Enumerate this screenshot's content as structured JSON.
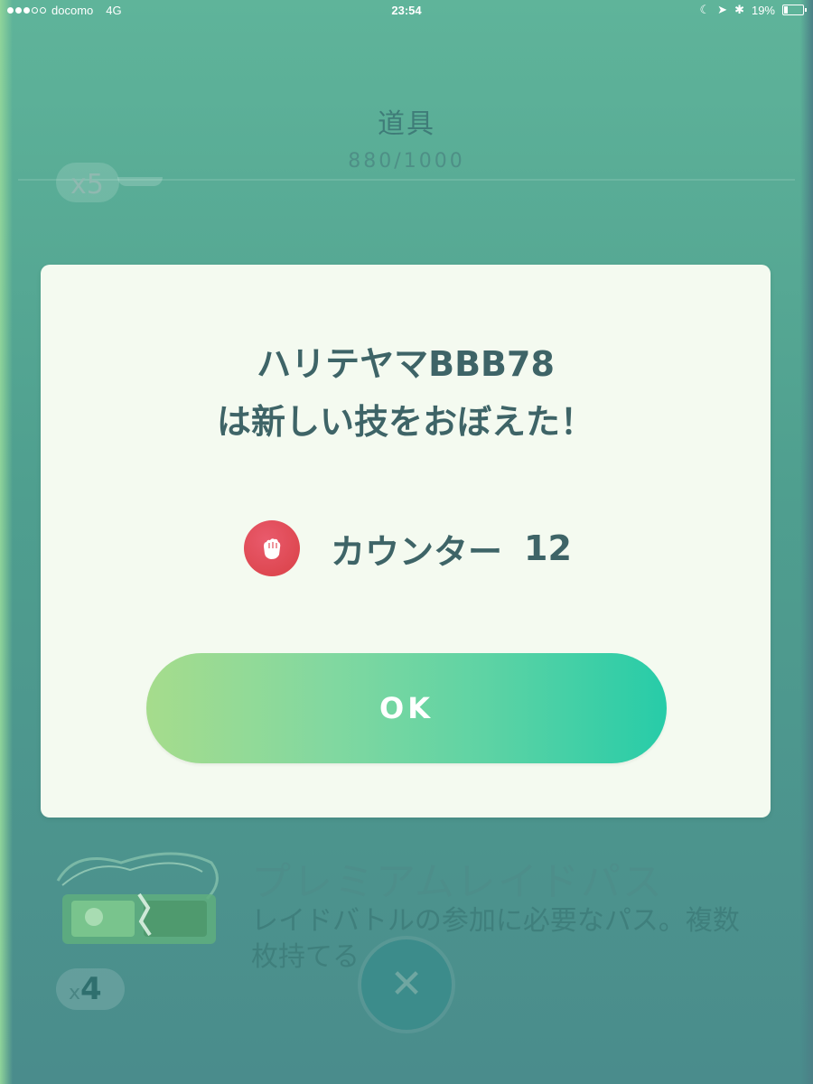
{
  "status_bar": {
    "carrier": "docomo",
    "network": "4G",
    "time": "23:54",
    "battery_percent": "19%",
    "battery_level": 0.19
  },
  "inventory": {
    "title": "道具",
    "count": "880/1000",
    "partial_item_count": "x5",
    "item": {
      "name": "プレミアムレイドパス",
      "description": "レイドバトルの参加に必要なパス。複数枚持てる",
      "count_prefix": "x",
      "count": "4"
    },
    "close_icon": "close-icon"
  },
  "dialog": {
    "title_line1": "ハリテヤマBBB78",
    "title_line2": "は新しい技をおぼえた！",
    "move_name": "カウンター",
    "move_power": "12",
    "move_type_icon": "fighting-type-icon",
    "ok_label": "OK"
  },
  "colors": {
    "accent_gradient_start": "#a6dc8c",
    "accent_gradient_end": "#27cca8",
    "fighting_type": "#d94046",
    "dialog_text": "#3e6467"
  }
}
